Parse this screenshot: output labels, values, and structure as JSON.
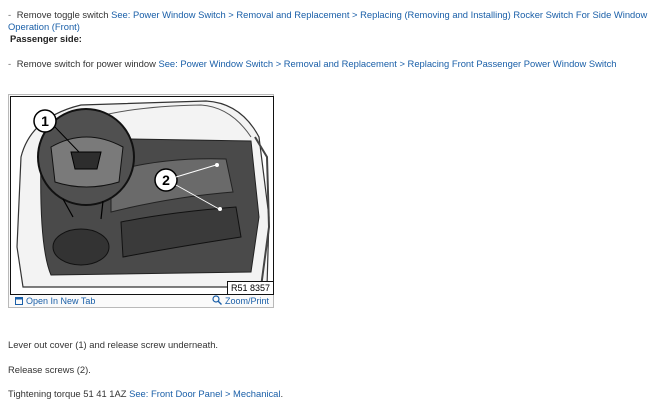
{
  "steps": [
    {
      "bullet": "-",
      "text": "Remove toggle switch",
      "link": "See: Power Window Switch > Removal and Replacement > Replacing (Removing and Installing) Rocker Switch For Side Window",
      "link_cont": "Operation (Front)"
    },
    {
      "heading": "Passenger side:"
    },
    {
      "bullet": "-",
      "text": "Remove switch for power window",
      "link": "See: Power Window Switch > Removal and Replacement > Replacing Front Passenger Power Window Switch"
    }
  ],
  "figure": {
    "callouts": [
      "1",
      "2"
    ],
    "figure_id": "R51 8357",
    "open_tab_label": "Open In New Tab",
    "zoom_label": "Zoom/Print",
    "open_tab_icon": "window-icon",
    "zoom_icon": "magnifier-icon"
  },
  "paragraphs": {
    "p1": "Lever out cover (1) and release screw underneath.",
    "p2": "Release screws (2).",
    "p3_text": "Tightening torque 51 41 1AZ",
    "p3_link": "See: Front Door Panel > Mechanical",
    "p3_end": "."
  },
  "colors": {
    "link": "#1a5fa8",
    "text": "#333333"
  }
}
